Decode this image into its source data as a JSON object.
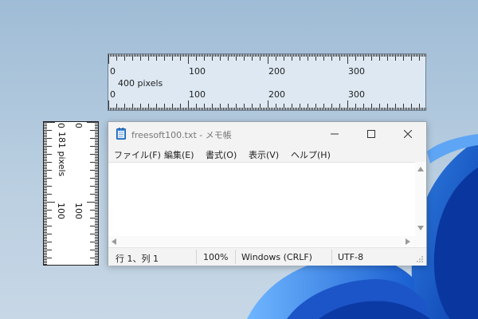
{
  "notepad": {
    "title": "freesoft100.txt - メモ帳",
    "menu": [
      "ファイル(F)",
      "編集(E)",
      "書式(O)",
      "表示(V)",
      "ヘルプ(H)"
    ],
    "status": {
      "position": "行 1、列 1",
      "zoom": "100%",
      "line_ending": "Windows (CRLF)",
      "encoding": "UTF-8"
    },
    "content": ""
  },
  "hruler": {
    "label": "400 pixels",
    "ticks": [
      "0",
      "100",
      "200",
      "300"
    ]
  },
  "vruler": {
    "label": "181 pixels",
    "ticks": [
      "0",
      "100"
    ]
  },
  "icons": {
    "app": "notepad-icon",
    "minimize": "minimize-icon",
    "maximize": "maximize-icon",
    "close": "close-icon"
  },
  "colors": {
    "accent": "#1a73e8",
    "ruler_bg": "#dde8f2"
  }
}
